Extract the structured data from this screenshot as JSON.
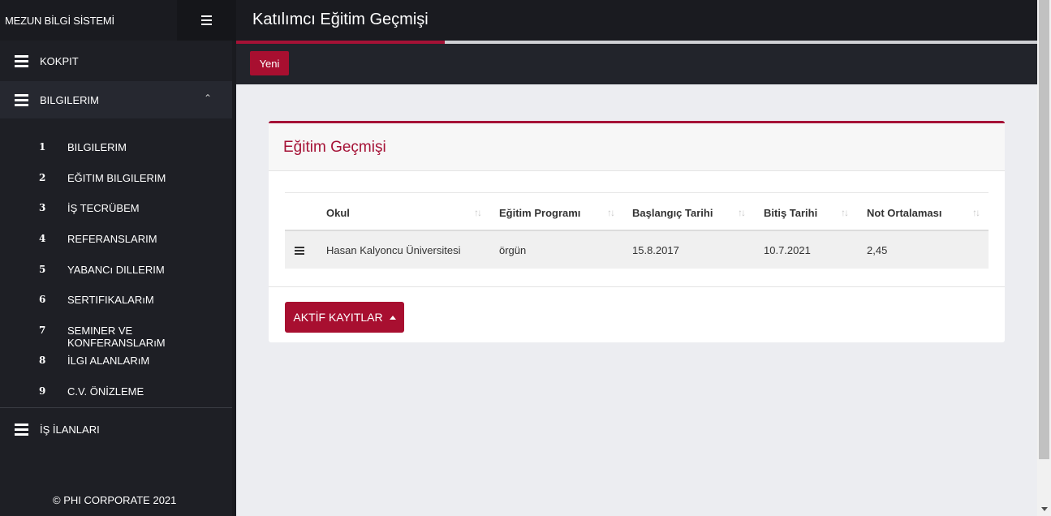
{
  "brand": "MEZUN BİLGİ SİSTEMİ",
  "sidebar": {
    "menu": [
      {
        "label": "KOKPIT"
      },
      {
        "label": "BILGILERIM"
      },
      {
        "label": "İŞ İLANLARI"
      }
    ],
    "submenu": [
      {
        "num": "1",
        "label": "BILGILERIM"
      },
      {
        "num": "2",
        "label": "EĞITIM BILGILERIM"
      },
      {
        "num": "3",
        "label": "İŞ TECRÜBEM"
      },
      {
        "num": "4",
        "label": "REFERANSLARIM"
      },
      {
        "num": "5",
        "label": "YABANCı DILLERIM"
      },
      {
        "num": "6",
        "label": "SERTIFIKALARıM"
      },
      {
        "num": "7",
        "label": "SEMINER VE KONFERANSLARıM"
      },
      {
        "num": "8",
        "label": "İLGI ALANLARıM"
      },
      {
        "num": "9",
        "label": "C.V. ÖNİZLEME"
      }
    ],
    "footer": "© PHI CORPORATE 2021"
  },
  "header": {
    "title": "Katılımcı Eğitim Geçmişi",
    "progress": 0.26
  },
  "toolbar": {
    "new_label": "Yeni"
  },
  "card": {
    "title": "Eğitim Geçmişi",
    "columns": [
      "Okul",
      "Eğitim Programı",
      "Başlangıç Tarihi",
      "Bitiş Tarihi",
      "Not Ortalaması"
    ],
    "rows": [
      {
        "okul": "Hasan Kalyoncu Üniversitesi",
        "program": "örgün",
        "baslangic": "15.8.2017",
        "bitis": "10.7.2021",
        "not": "2,45"
      }
    ],
    "active_records_label": "AKTİF KAYITLAR"
  },
  "colors": {
    "accent": "#a51236",
    "sidebar_bg": "#1e1f25",
    "content_bg": "#ecedf1"
  },
  "icons": [
    "menu-icon",
    "chevron-up-icon",
    "sort-icon",
    "drag-handle-icon",
    "caret-up-icon"
  ]
}
